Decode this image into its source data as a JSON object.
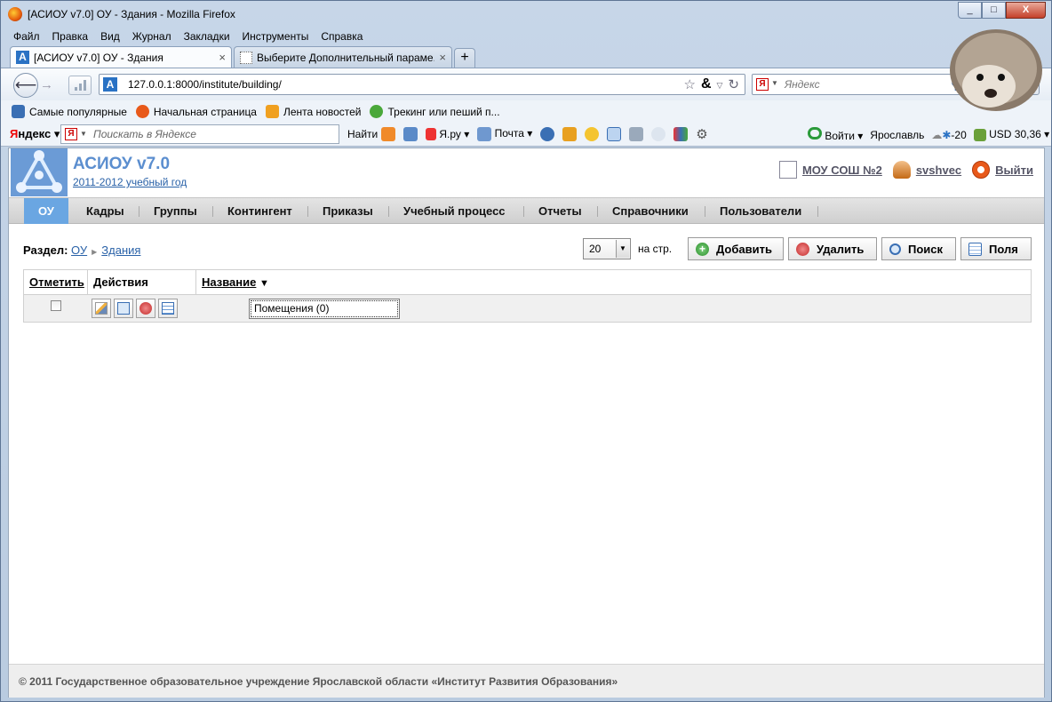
{
  "window": {
    "title": "[АСИОУ v7.0] ОУ - Здания - Mozilla Firefox",
    "controls": [
      "_",
      "□",
      "X"
    ]
  },
  "menu": [
    "Файл",
    "Правка",
    "Вид",
    "Журнал",
    "Закладки",
    "Инструменты",
    "Справка"
  ],
  "tabs": [
    {
      "label": "[АСИОУ v7.0] ОУ - Здания",
      "icon": "app-a-icon",
      "active": true
    },
    {
      "label": "Выберите Дополнительный параме...",
      "icon": "blank-page-icon",
      "active": false
    }
  ],
  "new_tab_label": "+",
  "navbar": {
    "url": "127.0.0.1:8000/institute/building/",
    "search_placeholder": "Яндекс"
  },
  "bookmarks": [
    {
      "label": "Самые популярные",
      "icon": "search-page-icon",
      "color": "#3a6fb4"
    },
    {
      "label": "Начальная страница",
      "icon": "firefox-icon",
      "color": "#e8591a"
    },
    {
      "label": "Лента новостей",
      "icon": "rss-icon",
      "color": "#f0a020"
    },
    {
      "label": "Трекинг или пеший п...",
      "icon": "green-logo-icon",
      "color": "#4aa83a"
    }
  ],
  "yandex_bar": {
    "logo_first": "Я",
    "logo_rest": "ндекс",
    "search_placeholder": "Поискать в Яндексе",
    "find_label": "Найти",
    "yaru_label": "Я.ру",
    "mail_label": "Почта",
    "login_label": "Войти",
    "city": "Ярославль",
    "temperature": "-20",
    "currency": "USD 30,36"
  },
  "app": {
    "title": "АСИОУ v7.0",
    "year_link": "2011-2012 учебный год",
    "school_link": "МОУ СОШ №2",
    "user_link": "svshvec",
    "logout_link": "Выйти"
  },
  "nav_tabs": [
    {
      "label": "ОУ",
      "active": true
    },
    {
      "label": "Кадры",
      "active": false
    },
    {
      "label": "Группы",
      "active": false
    },
    {
      "label": "Контингент",
      "active": false
    },
    {
      "label": "Приказы",
      "active": false
    },
    {
      "label": "Учебный процесс",
      "active": false
    },
    {
      "label": "Отчеты",
      "active": false
    },
    {
      "label": "Справочники",
      "active": false
    },
    {
      "label": "Пользователи",
      "active": false
    }
  ],
  "breadcrumb": {
    "prefix": "Раздел:",
    "items": [
      "ОУ",
      "Здания"
    ]
  },
  "toolbar": {
    "per_page_value": "20",
    "per_page_label": "на стр.",
    "add_label": "Добавить",
    "delete_label": "Удалить",
    "search_label": "Поиск",
    "columns_label": "Поля"
  },
  "grid": {
    "headers": {
      "mark": "Отметить",
      "actions": "Действия",
      "name": "Название"
    },
    "sort_indicator": "▼",
    "rows": [
      {
        "name": "Помещения (0)",
        "checked": false
      }
    ]
  },
  "footer": "© 2011 Государственное образовательное учреждение Ярославской области «Институт Развития Образования»"
}
